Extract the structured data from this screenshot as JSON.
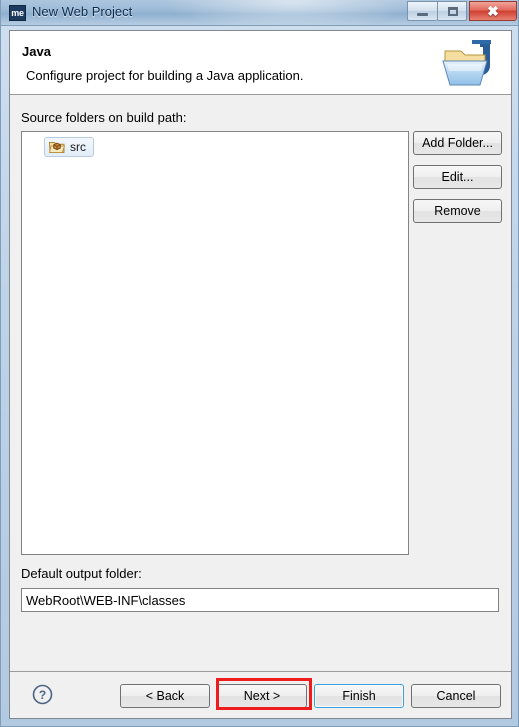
{
  "window": {
    "title": "New Web Project",
    "app_icon_text": "me",
    "controls": {
      "minimize": "minimize-button",
      "maximize": "maximize-button",
      "close": "✖"
    }
  },
  "header": {
    "title": "Java",
    "description": "Configure project for building a Java application.",
    "icon": "java-folder-icon"
  },
  "main": {
    "source_folders_label": "Source folders on build path:",
    "source_folders": [
      {
        "name": "src",
        "icon": "package-folder-icon",
        "selected": true
      }
    ],
    "side_buttons": [
      {
        "label": "Add Folder...",
        "name": "add-folder-button"
      },
      {
        "label": "Edit...",
        "name": "edit-button"
      },
      {
        "label": "Remove",
        "name": "remove-button"
      }
    ],
    "output_folder_label": "Default output folder:",
    "output_folder_value": "WebRoot\\WEB-INF\\classes"
  },
  "footer": {
    "help_icon": "?",
    "buttons": [
      {
        "label": "< Back",
        "name": "back-button",
        "focused": false
      },
      {
        "label": "Next >",
        "name": "next-button",
        "focused": false,
        "annotated": true
      },
      {
        "label": "Finish",
        "name": "finish-button",
        "focused": true
      },
      {
        "label": "Cancel",
        "name": "cancel-button",
        "focused": false
      }
    ]
  },
  "annotation": {
    "color": "#ee1c1c",
    "target": "Next >"
  },
  "colors": {
    "titlebar_text": "#0c2b4d",
    "dialog_bg": "#f0f0f0",
    "header_bg": "#ffffff",
    "focus_border": "#3c9ddc",
    "annotation_red": "#ee1c1c"
  }
}
